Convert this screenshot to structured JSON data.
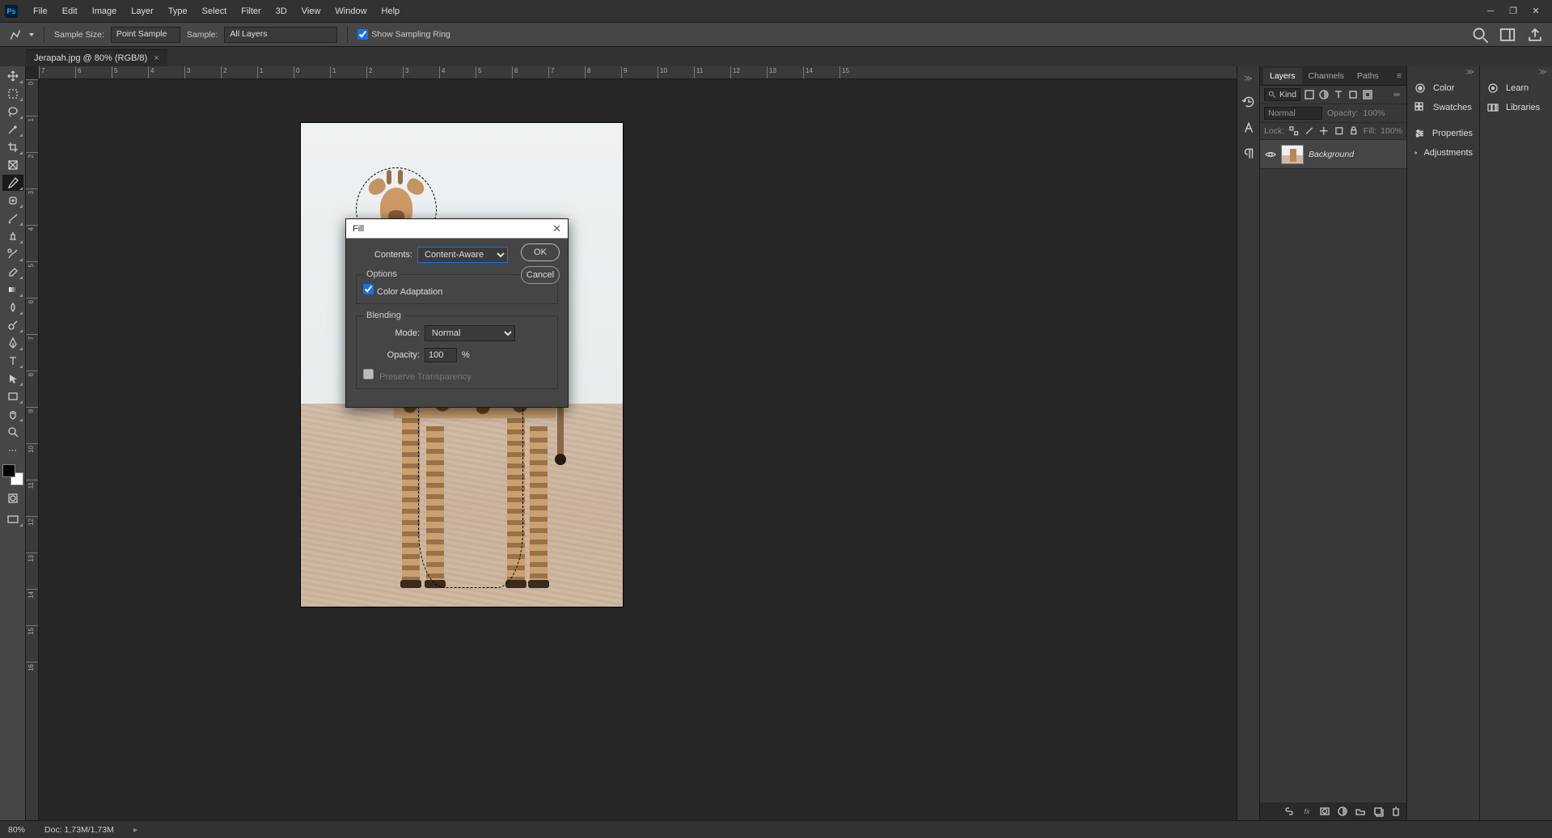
{
  "menu": [
    "File",
    "Edit",
    "Image",
    "Layer",
    "Type",
    "Select",
    "Filter",
    "3D",
    "View",
    "Window",
    "Help"
  ],
  "options": {
    "sample_size_label": "Sample Size:",
    "sample_size_value": "Point Sample",
    "sample_label": "Sample:",
    "sample_value": "All Layers",
    "show_ring": "Show Sampling Ring"
  },
  "doc_tab": "Jerapah.jpg @ 80% (RGB/8)",
  "ruler_h": [
    "7",
    "6",
    "5",
    "4",
    "3",
    "2",
    "1",
    "0",
    "1",
    "2",
    "3",
    "4",
    "5",
    "6",
    "7",
    "8",
    "9",
    "10",
    "11",
    "12",
    "13",
    "14",
    "15"
  ],
  "ruler_v": [
    "0",
    "1",
    "2",
    "3",
    "4",
    "5",
    "6",
    "7",
    "8",
    "9",
    "10",
    "11",
    "12",
    "13",
    "14",
    "15",
    "16"
  ],
  "dialog": {
    "title": "Fill",
    "contents_label": "Contents:",
    "contents_value": "Content-Aware",
    "options_legend": "Options",
    "color_adapt": "Color Adaptation",
    "blending_legend": "Blending",
    "mode_label": "Mode:",
    "mode_value": "Normal",
    "opacity_label": "Opacity:",
    "opacity_value": "100",
    "opacity_unit": "%",
    "preserve_trans": "Preserve Transparency",
    "ok": "OK",
    "cancel": "Cancel"
  },
  "layers_panel": {
    "tabs": [
      "Layers",
      "Channels",
      "Paths"
    ],
    "kind_placeholder": "Kind",
    "blend_mode": "Normal",
    "opacity_label": "Opacity:",
    "opacity_value": "100%",
    "lock_label": "Lock:",
    "fill_label": "Fill:",
    "fill_value": "100%",
    "layer_name": "Background"
  },
  "side_mini_left": {
    "color": "Color",
    "swatches": "Swatches"
  },
  "side_mini_right": {
    "learn": "Learn",
    "libraries": "Libraries"
  },
  "side_mini_mid": {
    "properties": "Properties",
    "adjustments": "Adjustments"
  },
  "status": {
    "zoom": "80%",
    "doc_size": "Doc: 1,73M/1,73M"
  }
}
